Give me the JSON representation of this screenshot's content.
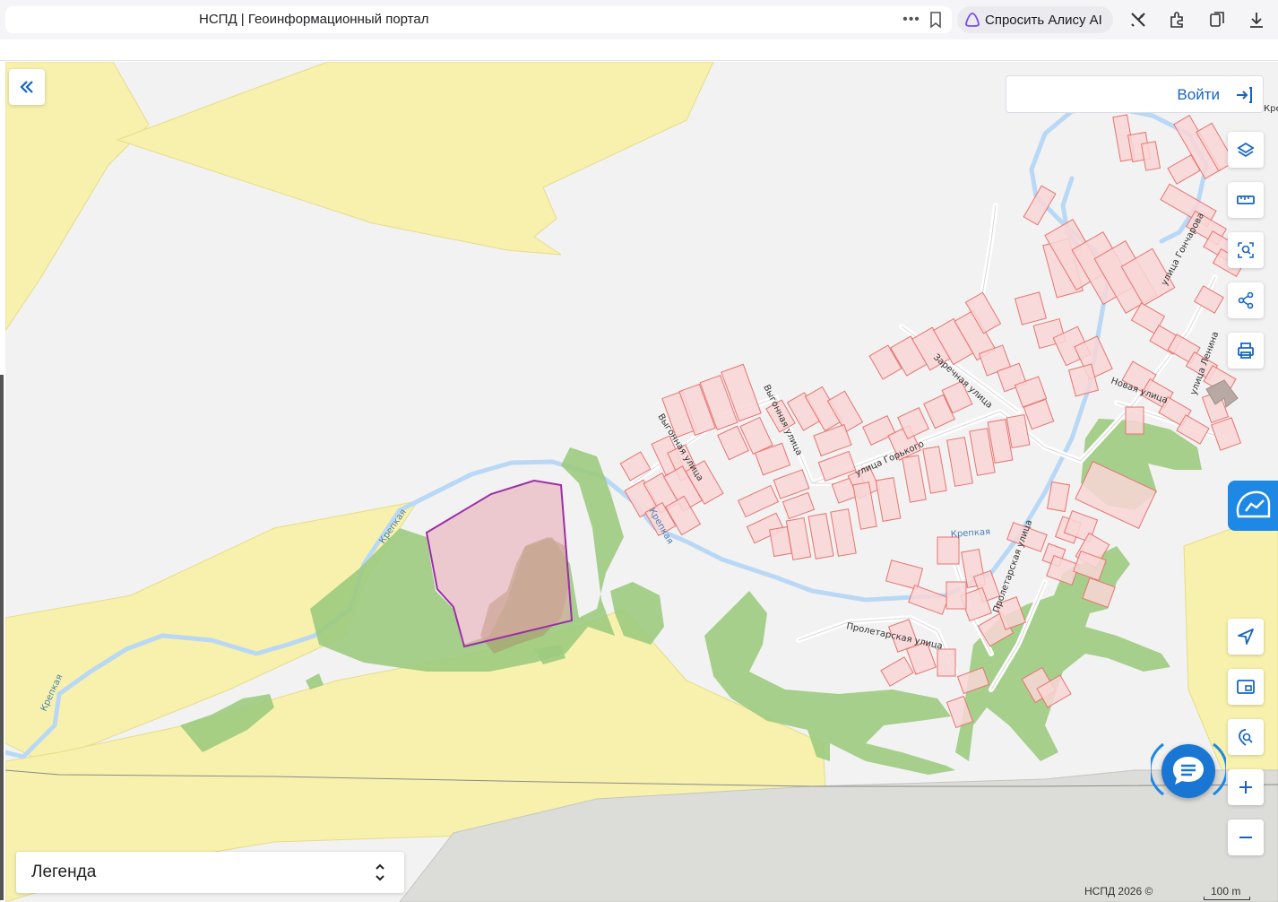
{
  "browser": {
    "page_title": "НСПД | Геоинформационный портал",
    "alice_label": "Спросить Алису AI",
    "icons": [
      "more-icon",
      "bookmark-icon",
      "alice-icon",
      "tools-icon",
      "extensions-icon",
      "collections-icon",
      "download-icon"
    ]
  },
  "map": {
    "login_label": "Войти",
    "legend_label": "Легенда",
    "attribution": "НСПД 2026 ©",
    "scale_label": "100 m",
    "edge_label": "Кре",
    "labels": {
      "zarechnaya": "Заречная улица",
      "vygonnaya_a": "Выгонная улица",
      "vygonnaya_b": "Выгонная улица",
      "gorkogo": "улица Горького",
      "goncharova": "улица Гончарова",
      "lenina": "улица Ленина",
      "novaya": "Новая улица",
      "proletarskaya_a": "Пролетарская улица",
      "proletarskaya_b": "Пролетарская улица",
      "kreлкая_1": "Крепкая",
      "krelkaya_2": "Крепкая",
      "krelkaya_3": "Крепкая",
      "krelkaya_4": "Крепкая"
    },
    "colors": {
      "background": "#f2f2f3",
      "agricultural": "#f7f1ad",
      "forest": "#9ccb7f",
      "parcel_fill": "#f9d6d6",
      "parcel_stroke": "#e7746f",
      "selected_parcel_stroke": "#9b2fa8",
      "river": "#b9d8f5",
      "accent": "#1e88e5"
    }
  },
  "controls": {
    "collapse": "chevrons-left-icon",
    "side": [
      "layers-icon",
      "ruler-icon",
      "area-search-icon",
      "share-icon",
      "print-icon",
      "locate-icon",
      "minimap-icon",
      "geo-search-icon",
      "zoom-in-icon",
      "zoom-out-icon"
    ]
  }
}
